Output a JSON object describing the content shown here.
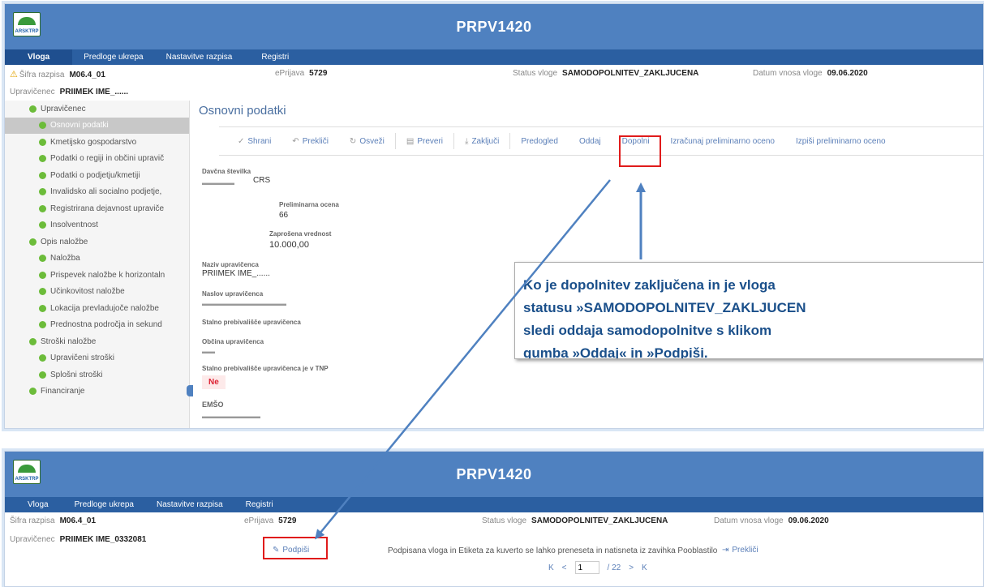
{
  "app": {
    "title": "PRPV1420",
    "logo_text": "ARSKTRP"
  },
  "menu": [
    {
      "label": "Vloga"
    },
    {
      "label": "Predloge ukrepa"
    },
    {
      "label": "Nastavitve razpisa"
    },
    {
      "label": "Registri"
    }
  ],
  "info": {
    "sifra_label": "Šifra razpisa",
    "sifra_value": "M06.4_01",
    "eprijava_label": "ePrijava",
    "eprijava_value": "5729",
    "status_label": "Status vloge",
    "status_value": "SAMODOPOLNITEV_ZAKLJUCENA",
    "datum_label": "Datum vnosa vloge",
    "datum_value": "09.06.2020",
    "upr_label": "Upravičenec",
    "upr_value_1": "PRIIMEK IME_......",
    "upr_value_2": "PRIIMEK IME_0332081"
  },
  "sidebar": [
    {
      "label": "Upravičenec"
    },
    {
      "label": "Osnovni podatki"
    },
    {
      "label": "Kmetijsko gospodarstvo"
    },
    {
      "label": "Podatki o regiji in občini upravič"
    },
    {
      "label": "Podatki o podjetju/kmetiji"
    },
    {
      "label": "Invalidsko ali socialno podjetje,"
    },
    {
      "label": "Registrirana dejavnost upraviče"
    },
    {
      "label": "Insolventnost"
    },
    {
      "label": "Opis naložbe"
    },
    {
      "label": "Naložba"
    },
    {
      "label": "Prispevek naložbe k horizontaln"
    },
    {
      "label": "Učinkovitost naložbe"
    },
    {
      "label": "Lokacija prevladujoče naložbe"
    },
    {
      "label": "Prednostna področja in sekund"
    },
    {
      "label": "Stroški naložbe"
    },
    {
      "label": "Upravičeni stroški"
    },
    {
      "label": "Splošni stroški"
    },
    {
      "label": "Financiranje"
    }
  ],
  "content": {
    "title": "Osnovni podatki",
    "toolbar": [
      "Shrani",
      "Prekliči",
      "Osveži",
      "Preveri",
      "Zaključi",
      "Predogled",
      "Oddaj",
      "Dopolni",
      "Izračunaj preliminarno oceno",
      "Izpiši preliminarno oceno"
    ],
    "fields": {
      "davcna_label": "Davčna številka",
      "davcna_sub": "CRS",
      "prelim_label": "Preliminarna ocena",
      "prelim_value": "66",
      "zaprosena_label": "Zaprošena vrednost",
      "zaprosena_value": "10.000,00",
      "naziv_label": "Naziv upravičenca",
      "naziv_value": "PRIIMEK IME_......",
      "naslov_label": "Naslov upravičenca",
      "stalno_label": "Stalno prebivališče upravičenca",
      "obcina_label": "Občina upravičenca",
      "tnp_label": "Stalno prebivališče upravičenca je v TNP",
      "tnp_value": "Ne",
      "emso_label": "EMŠO"
    }
  },
  "callout": {
    "line1": "Ko je dopolnitev zaključena in je vloga",
    "line2": "statusu »SAMODOPOLNITEV_ZAKLJUCEN",
    "line3": "sledi oddaja samodopolnitve s klikom",
    "line4": "gumba »Oddaj« in »Podpiši."
  },
  "sign": {
    "button": "Podpiši",
    "note": "Podpisana vloga in Etiketa za kuverto se lahko preneseta in natisneta iz zavihka Pooblastilo",
    "cancel": "Prekliči",
    "page": "1",
    "total": "/ 22"
  },
  "colors": {
    "banner": "#4f81c0",
    "menubar": "#2b5fa1",
    "accent": "#e01b1b"
  }
}
